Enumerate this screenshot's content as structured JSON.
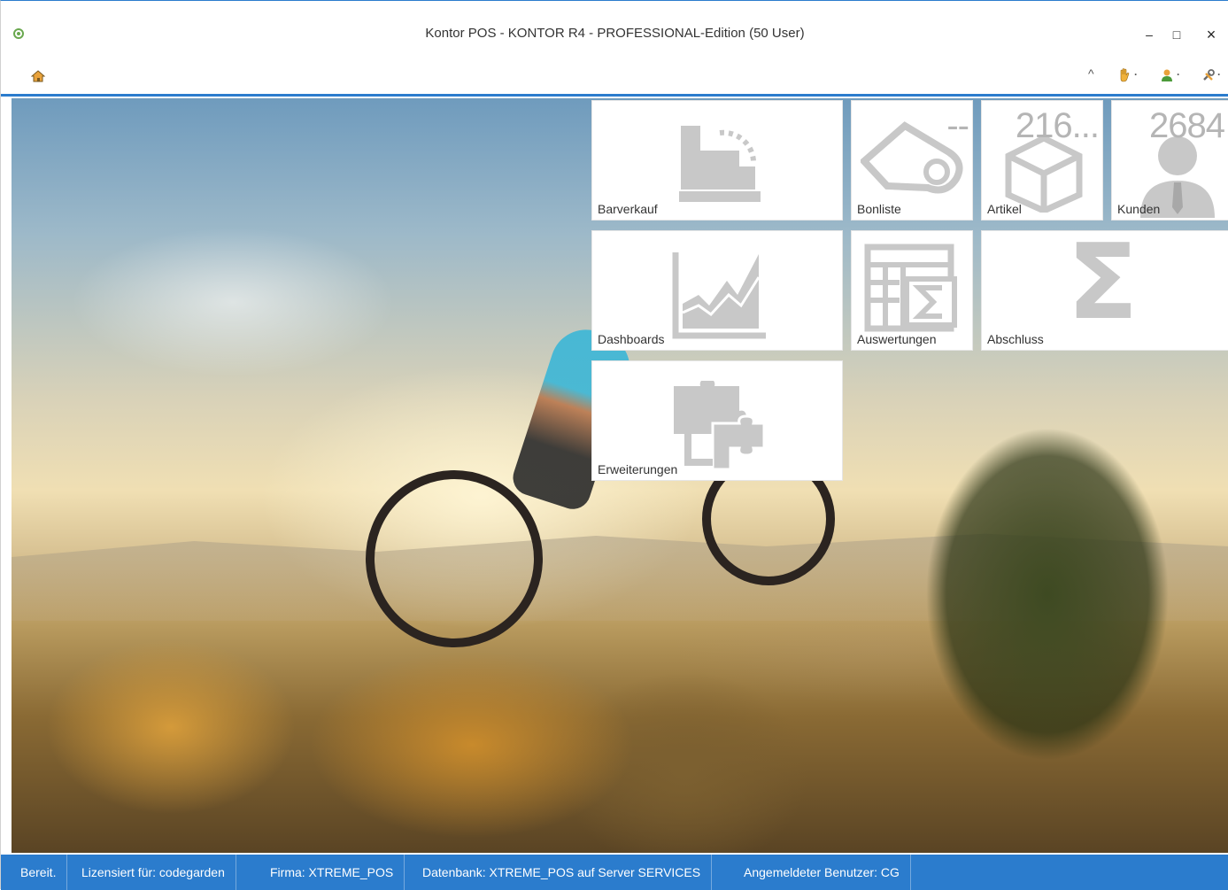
{
  "window": {
    "title": "Kontor POS - KONTOR R4 - PROFESSIONAL-Edition (50 User)",
    "minimize": "–",
    "maximize": "□",
    "close": "×"
  },
  "toolbar": {
    "collapse": "^",
    "drop": "·"
  },
  "tiles": [
    {
      "label": "Barverkauf",
      "icon": "cash-register-icon"
    },
    {
      "label": "Bonliste",
      "icon": "receipt-roll-icon",
      "count": "--"
    },
    {
      "label": "Artikel",
      "icon": "box-icon",
      "count": "216..."
    },
    {
      "label": "Kunden",
      "icon": "person-icon",
      "count": "2684"
    },
    {
      "label": "Dashboards",
      "icon": "area-chart-icon"
    },
    {
      "label": "Auswertungen",
      "icon": "report-sum-icon"
    },
    {
      "label": "Abschluss",
      "icon": "sigma-icon",
      "symbol": "Σ"
    },
    {
      "label": "Erweiterungen",
      "icon": "puzzle-icon"
    }
  ],
  "statusbar": {
    "ready": "Bereit.",
    "license": "Lizensiert für: codegarden",
    "company": "Firma: XTREME_POS",
    "database": "Datenbank: XTREME_POS auf Server SERVICES",
    "user": "Angemeldeter Benutzer: CG"
  },
  "colors": {
    "accent": "#2b7ccd",
    "tile_icon": "#c8c8c8"
  }
}
